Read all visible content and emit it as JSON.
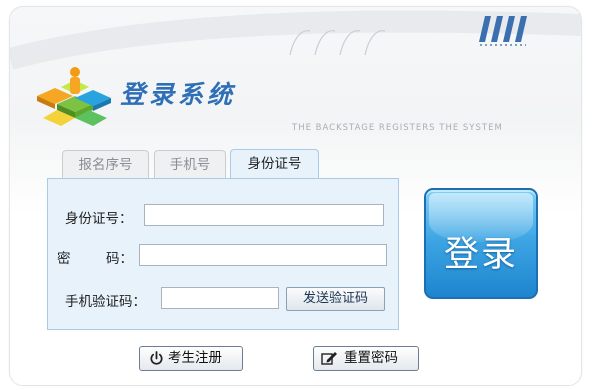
{
  "header": {
    "title": "登录系统",
    "subtitle": "THE BACKSTAGE REGISTERS THE SYSTEM"
  },
  "tabs": [
    {
      "label": "报名序号",
      "active": false
    },
    {
      "label": "手机号",
      "active": false
    },
    {
      "label": "身份证号",
      "active": true
    }
  ],
  "form": {
    "id_label": "身份证号：",
    "id_value": "",
    "password_label_1": "密",
    "password_label_2": "码：",
    "password_value": "",
    "sms_label": "手机验证码：",
    "sms_value": "",
    "send_code_button": "发送验证码"
  },
  "login_button": "登录",
  "footer": {
    "register_button": "考生注册",
    "reset_password_button": "重置密码"
  },
  "colors": {
    "accent": "#2f6fb7",
    "login_button": "#3fa6e4",
    "form_bg": "#e7f2fb"
  },
  "icons": {
    "register": "power-icon",
    "reset": "edit-icon"
  }
}
